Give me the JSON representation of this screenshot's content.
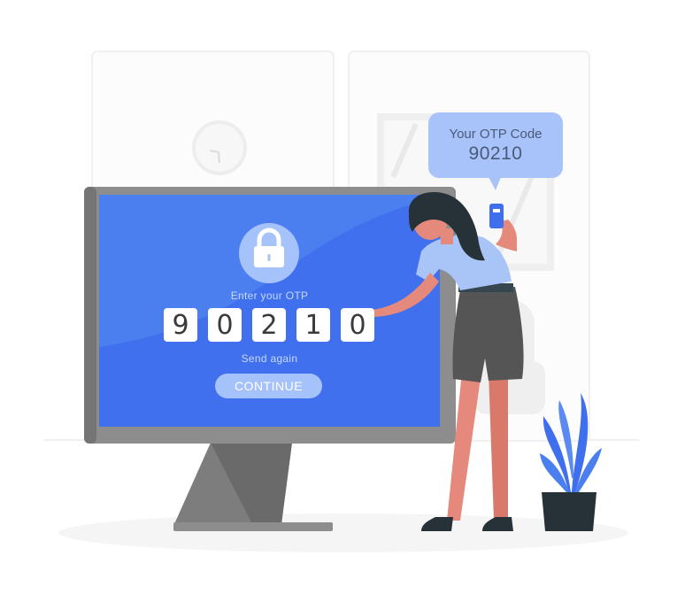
{
  "bubble": {
    "title": "Your OTP Code",
    "code": "90210"
  },
  "screen": {
    "prompt": "Enter your OTP",
    "digits": [
      "9",
      "0",
      "2",
      "1",
      "0"
    ],
    "send_again": "Send again",
    "continue_label": "CONTINUE"
  },
  "colors": {
    "screen_blue": "#4b7ff0",
    "accent_blue": "#3f6fec",
    "monitor_gray": "#8d8d8d",
    "pot": "#263238",
    "skin": "#e4897b",
    "shirt": "#a9c4f7",
    "shorts": "#555555"
  },
  "icons": [
    "lock-icon",
    "clock-icon",
    "phone-icon",
    "plant-icon"
  ]
}
